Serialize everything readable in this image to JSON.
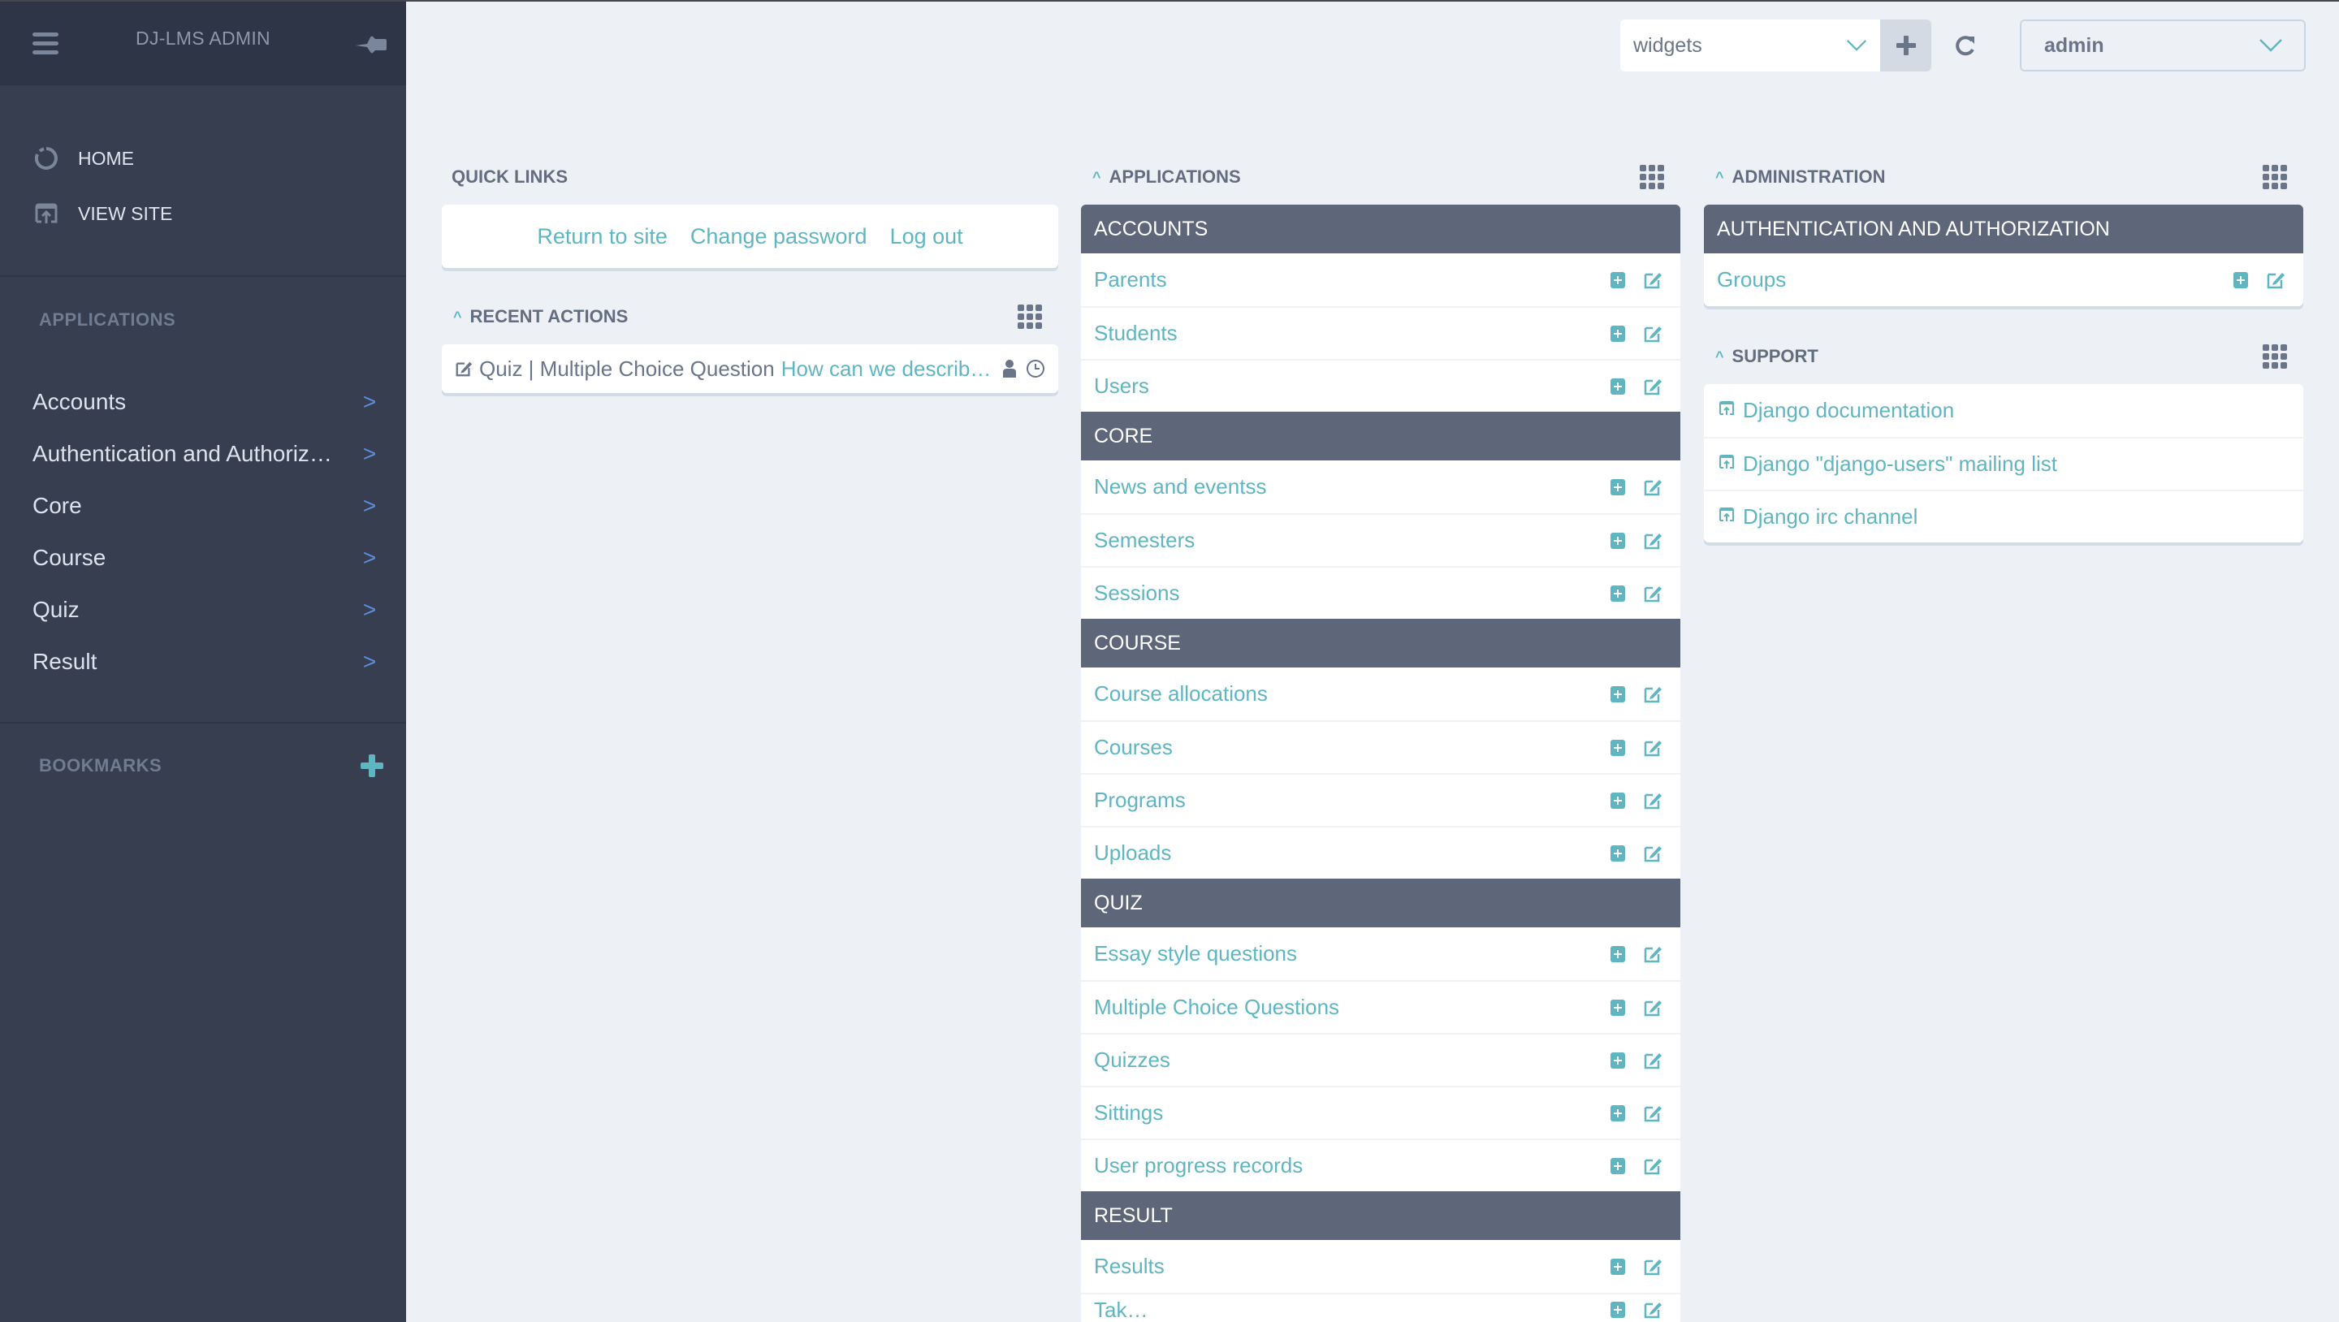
{
  "sidebar": {
    "title": "DJ-LMS ADMIN",
    "nav": [
      {
        "label": "HOME",
        "icon": "home-icon"
      },
      {
        "label": "VIEW SITE",
        "icon": "view-site-icon"
      }
    ],
    "applications_label": "APPLICATIONS",
    "apps": [
      {
        "label": "Accounts"
      },
      {
        "label": "Authentication and Authoriz…"
      },
      {
        "label": "Core"
      },
      {
        "label": "Course"
      },
      {
        "label": "Quiz"
      },
      {
        "label": "Result"
      }
    ],
    "bookmarks_label": "BOOKMARKS"
  },
  "topbar": {
    "widgets_select_value": "widgets",
    "user_select_value": "admin"
  },
  "quick_links": {
    "title": "QUICK LINKS",
    "links": [
      "Return to site",
      "Change password",
      "Log out"
    ]
  },
  "recent_actions": {
    "title": "RECENT ACTIONS",
    "items": [
      {
        "type": "Quiz | Multiple Choice Question",
        "object": "How can we describ…"
      }
    ]
  },
  "applications": {
    "title": "APPLICATIONS",
    "modules": [
      {
        "name": "ACCOUNTS",
        "models": [
          "Parents",
          "Students",
          "Users"
        ]
      },
      {
        "name": "CORE",
        "models": [
          "News and eventss",
          "Semesters",
          "Sessions"
        ]
      },
      {
        "name": "COURSE",
        "models": [
          "Course allocations",
          "Courses",
          "Programs",
          "Uploads"
        ]
      },
      {
        "name": "QUIZ",
        "models": [
          "Essay style questions",
          "Multiple Choice Questions",
          "Quizzes",
          "Sittings",
          "User progress records"
        ]
      },
      {
        "name": "RESULT",
        "models": [
          "Results",
          "Tak…"
        ]
      }
    ]
  },
  "administration": {
    "title": "ADMINISTRATION",
    "modules": [
      {
        "name": "AUTHENTICATION AND AUTHORIZATION",
        "models": [
          "Groups"
        ]
      }
    ]
  },
  "support": {
    "title": "SUPPORT",
    "links": [
      "Django documentation",
      "Django \"django-users\" mailing list",
      "Django irc channel"
    ]
  },
  "colors": {
    "accent": "#5fb6c1",
    "sidebar_bg": "#363e4f",
    "sidebar_header_bg": "#2e3546",
    "module_header_bg": "#5d6779",
    "page_bg": "#edf1f5",
    "sidebar_chevron": "#5b8fe0"
  }
}
